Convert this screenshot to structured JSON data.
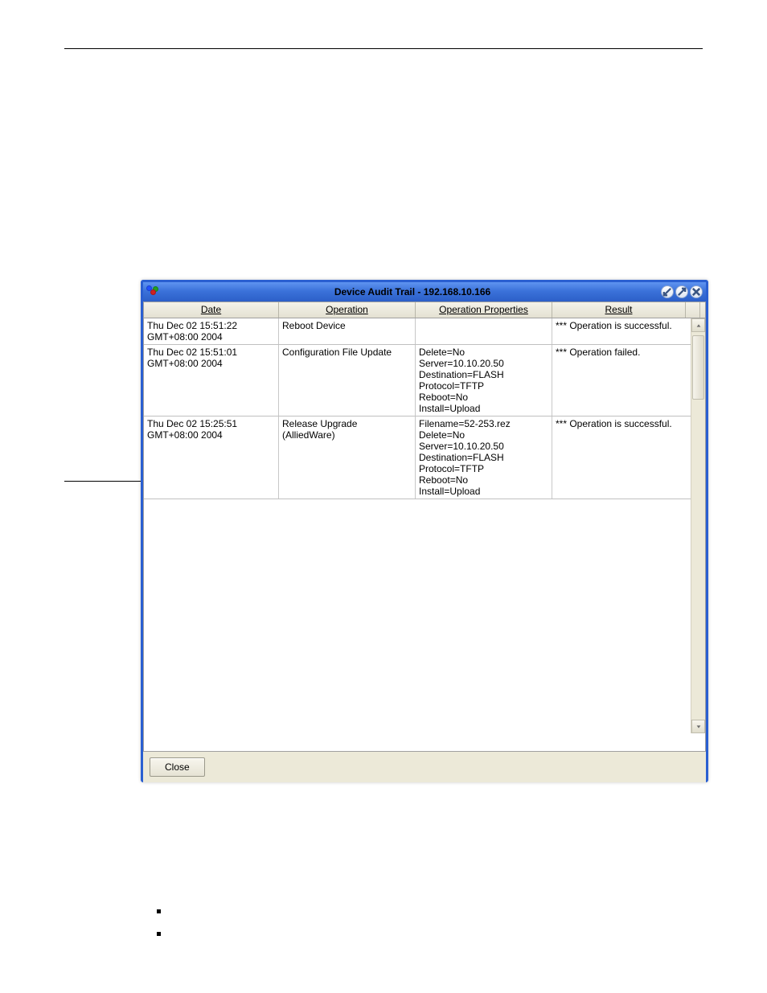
{
  "window": {
    "title": "Device Audit Trail - 192.168.10.166"
  },
  "columns": {
    "date": "Date",
    "operation": "Operation",
    "properties": "Operation Properties",
    "result": "Result"
  },
  "rows": [
    {
      "date": "Thu Dec 02 15:51:22\nGMT+08:00 2004",
      "operation": "Reboot Device",
      "properties": "",
      "result": "*** Operation is successful."
    },
    {
      "date": "Thu Dec 02 15:51:01\nGMT+08:00 2004",
      "operation": "Configuration File Update",
      "properties": "Delete=No\nServer=10.10.20.50\nDestination=FLASH\nProtocol=TFTP\nReboot=No\nInstall=Upload",
      "result": "*** Operation failed."
    },
    {
      "date": "Thu Dec 02 15:25:51\nGMT+08:00 2004",
      "operation": "Release Upgrade (AlliedWare)",
      "properties": "Filename=52-253.rez\nDelete=No\nServer=10.10.20.50\nDestination=FLASH\nProtocol=TFTP\nReboot=No\nInstall=Upload",
      "result": "*** Operation is successful."
    }
  ],
  "footer": {
    "close": "Close"
  }
}
